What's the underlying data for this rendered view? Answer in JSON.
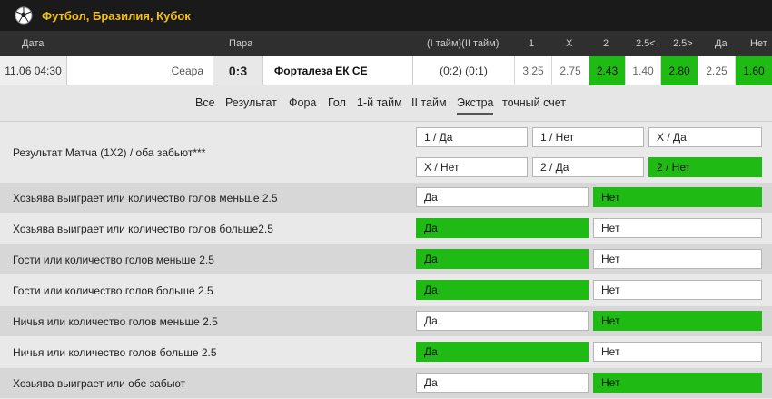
{
  "header": {
    "title": "Футбол, Бразилия, Кубок"
  },
  "columns": {
    "date": "Дата",
    "pair": "Пара",
    "halves": "(I тайм)(II тайм)",
    "c1": "1",
    "cx": "X",
    "c2": "2",
    "under": "2.5<",
    "over": "2.5>",
    "yes": "Да",
    "no": "Нет"
  },
  "match": {
    "date": "11.06 04:30",
    "home": "Сеара",
    "score": "0:3",
    "away": "Форталеза ЕК СЕ",
    "halves": "(0:2) (0:1)",
    "odds": [
      "3.25",
      "2.75",
      "2.43",
      "1.40",
      "2.80",
      "2.25",
      "1.60"
    ],
    "odds_green": [
      false,
      false,
      true,
      false,
      true,
      false,
      true
    ]
  },
  "tabs": [
    {
      "label": "Все"
    },
    {
      "label": "Результат"
    },
    {
      "label": "Фора"
    },
    {
      "label": "Гол"
    },
    {
      "label": "1-й тайм"
    },
    {
      "label": "II тайм"
    },
    {
      "label": "Экстра"
    },
    {
      "label": "точный счет"
    }
  ],
  "active_tab": "Экстра",
  "result_1x2": {
    "label": "Результат Матча (1X2) / оба забьют***",
    "options": [
      {
        "label": "1 / Да",
        "won": false
      },
      {
        "label": "1 / Нет",
        "won": false
      },
      {
        "label": "X / Да",
        "won": false
      },
      {
        "label": "X / Нет",
        "won": false
      },
      {
        "label": "2 / Да",
        "won": false
      },
      {
        "label": "2 / Нет",
        "won": true
      }
    ]
  },
  "markets": [
    {
      "label": "Хозьява выиграет или количество голов меньше 2.5",
      "yes": "Да",
      "no": "Нет",
      "winner": "no"
    },
    {
      "label": "Хозьява выиграет или количество голов больше2.5",
      "yes": "Да",
      "no": "Нет",
      "winner": "yes"
    },
    {
      "label": "Гости или количество голов меньше 2.5",
      "yes": "Да",
      "no": "Нет",
      "winner": "yes"
    },
    {
      "label": "Гости или количество голов больше 2.5",
      "yes": "Да",
      "no": "Нет",
      "winner": "yes"
    },
    {
      "label": "Ничья или количество голов меньше 2.5",
      "yes": "Да",
      "no": "Нет",
      "winner": "no"
    },
    {
      "label": "Ничья или количество голов больше 2.5",
      "yes": "Да",
      "no": "Нет",
      "winner": "yes"
    },
    {
      "label": "Хозьява выиграет или обе забьют",
      "yes": "Да",
      "no": "Нет",
      "winner": "no"
    }
  ],
  "colors": {
    "green": "#1fbb14",
    "gold": "#f2c11d",
    "dark": "#1a1a1a"
  },
  "icons": {
    "sport": "soccer-ball-icon"
  }
}
